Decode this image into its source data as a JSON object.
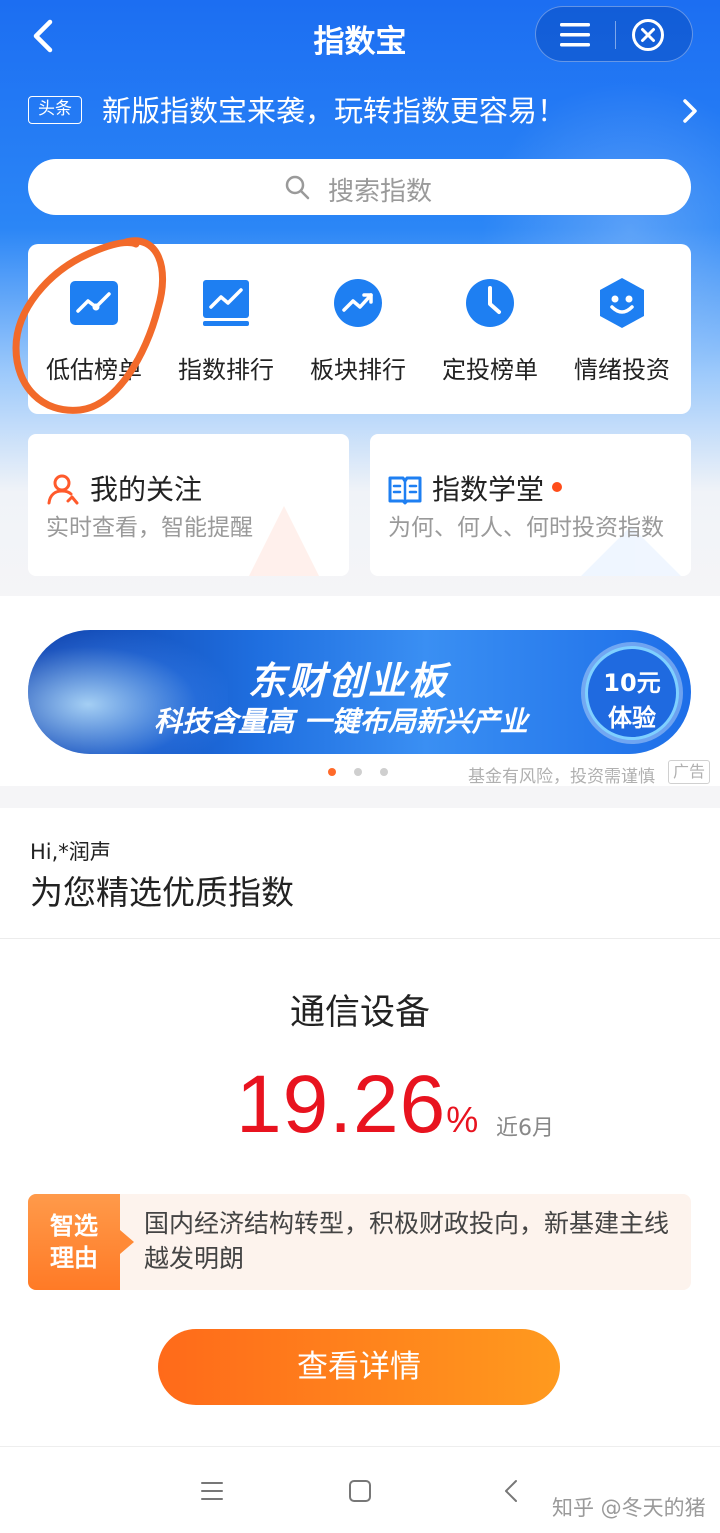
{
  "header": {
    "title": "指数宝"
  },
  "headline": {
    "tag": "头条",
    "text": "新版指数宝来袭，玩转指数更容易！"
  },
  "search": {
    "placeholder": "搜索指数"
  },
  "quick_entries": [
    {
      "label": "低估榜单",
      "icon": "trend-chart-icon"
    },
    {
      "label": "指数排行",
      "icon": "chart-board-icon"
    },
    {
      "label": "板块排行",
      "icon": "trend-circle-icon"
    },
    {
      "label": "定投榜单",
      "icon": "clock-icon"
    },
    {
      "label": "情绪投资",
      "icon": "smile-badge-icon"
    }
  ],
  "cards": [
    {
      "title": "我的关注",
      "subtitle": "实时查看，智能提醒",
      "icon": "user-follow-icon"
    },
    {
      "title": "指数学堂",
      "subtitle": "为何、何人、何时投资指数",
      "icon": "book-icon"
    }
  ],
  "banner": {
    "line1": "东财创业板",
    "line2": "科技含量高 一键布局新兴产业",
    "badge_line1": "10元",
    "badge_line2": "体验",
    "risk_note": "基金有风险，投资需谨慎",
    "ad_tag": "广告",
    "active_slide": 1,
    "slide_count": 3
  },
  "pick": {
    "greeting": "Hi,*润声",
    "title": "为您精选优质指数",
    "index_name": "通信设备",
    "return_value": "19.26",
    "return_unit": "%",
    "period": "近6月",
    "reason_tag_line1": "智选",
    "reason_tag_line2": "理由",
    "reason_text": "国内经济结构转型，积极财政投向，新基建主线越发明朗",
    "cta_label": "查看详情"
  },
  "watermark": "知乎 @冬天的猪",
  "colors": {
    "primary_blue": "#1c6ef2",
    "return_red": "#e8131f",
    "cta_orange": "#ff7a1e",
    "annotation_orange": "#f26a2a"
  }
}
